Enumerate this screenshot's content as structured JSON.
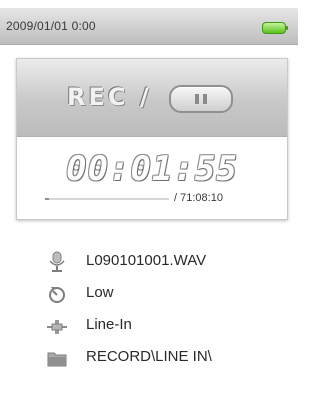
{
  "status": {
    "datetime": "2009/01/01  0:00",
    "battery_icon": "battery-full-icon",
    "battery_color": "#59c31f"
  },
  "recording": {
    "state_label": "REC /",
    "control_icon": "pause-icon",
    "elapsed_time": "00:01:55",
    "total_time": "/ 71:08:10",
    "progress_fraction": 0.03
  },
  "info": {
    "items": [
      {
        "icon": "microphone-icon",
        "label": "L090101001.WAV"
      },
      {
        "icon": "quality-dial-icon",
        "label": "Low"
      },
      {
        "icon": "line-in-source-icon",
        "label": "Line-In"
      },
      {
        "icon": "folder-icon",
        "label": "RECORD\\LINE IN\\"
      }
    ]
  }
}
